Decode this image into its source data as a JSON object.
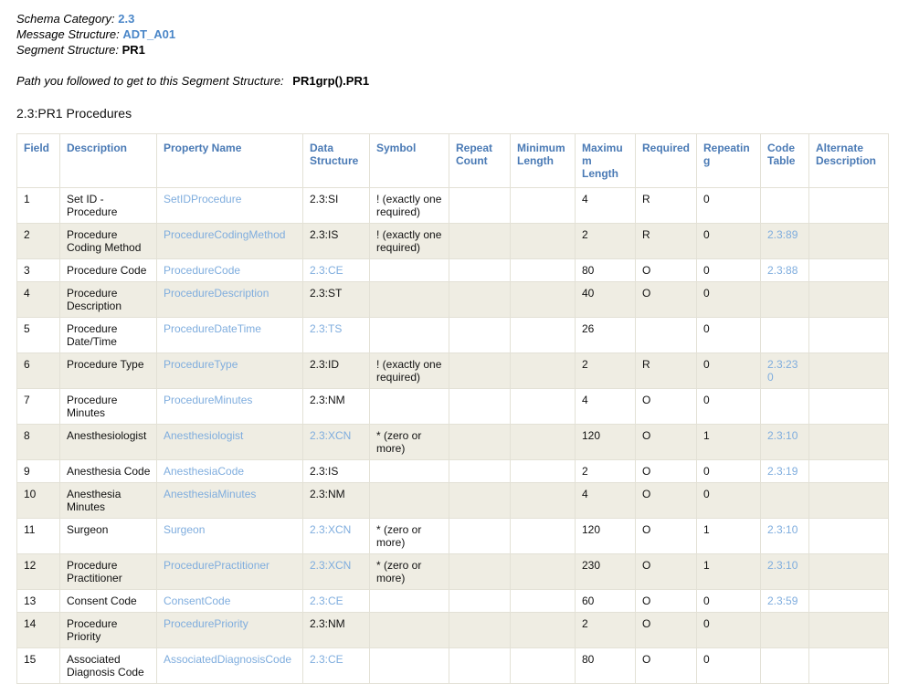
{
  "meta": {
    "schema_category_label": "Schema Category:",
    "schema_category_value": "2.3",
    "message_structure_label": "Message Structure:",
    "message_structure_value": "ADT_A01",
    "segment_structure_label": "Segment Structure:",
    "segment_structure_value": "PR1"
  },
  "path": {
    "label": "Path you followed to get to this Segment Structure:",
    "value": "PR1grp().PR1"
  },
  "section": {
    "title": "2.3:PR1 Procedures"
  },
  "colors": {
    "header_text": "#4a7ab5",
    "link": "#7fadde",
    "meta_link": "#4a86c8",
    "row_alt_bg": "#efede3",
    "border": "#e3e1d6"
  },
  "table": {
    "columns": [
      "Field",
      "Description",
      "Property Name",
      "Data Structure",
      "Symbol",
      "Repeat Count",
      "Minimum Length",
      "Maximum Length",
      "Required",
      "Repeating",
      "Code Table",
      "Alternate Description"
    ],
    "rows": [
      {
        "field": "1",
        "description": "Set ID - Procedure",
        "property_name": "SetIDProcedure",
        "property_name_link": true,
        "data_structure": "2.3:SI",
        "data_structure_link": false,
        "symbol": "! (exactly one required)",
        "repeat_count": "",
        "minimum_length": "",
        "maximum_length": "4",
        "required": "R",
        "repeating": "0",
        "code_table": "",
        "code_table_link": false,
        "alternate_description": ""
      },
      {
        "field": "2",
        "description": "Procedure Coding Method",
        "property_name": "ProcedureCodingMethod",
        "property_name_link": true,
        "data_structure": "2.3:IS",
        "data_structure_link": false,
        "symbol": "! (exactly one required)",
        "repeat_count": "",
        "minimum_length": "",
        "maximum_length": "2",
        "required": "R",
        "repeating": "0",
        "code_table": "2.3:89",
        "code_table_link": true,
        "alternate_description": ""
      },
      {
        "field": "3",
        "description": "Procedure Code",
        "property_name": "ProcedureCode",
        "property_name_link": true,
        "data_structure": "2.3:CE",
        "data_structure_link": true,
        "symbol": "",
        "repeat_count": "",
        "minimum_length": "",
        "maximum_length": "80",
        "required": "O",
        "repeating": "0",
        "code_table": "2.3:88",
        "code_table_link": true,
        "alternate_description": ""
      },
      {
        "field": "4",
        "description": "Procedure Description",
        "property_name": "ProcedureDescription",
        "property_name_link": true,
        "data_structure": "2.3:ST",
        "data_structure_link": false,
        "symbol": "",
        "repeat_count": "",
        "minimum_length": "",
        "maximum_length": "40",
        "required": "O",
        "repeating": "0",
        "code_table": "",
        "code_table_link": false,
        "alternate_description": ""
      },
      {
        "field": "5",
        "description": "Procedure Date/Time",
        "property_name": "ProcedureDateTime",
        "property_name_link": true,
        "data_structure": "2.3:TS",
        "data_structure_link": true,
        "symbol": "",
        "repeat_count": "",
        "minimum_length": "",
        "maximum_length": "26",
        "required": "",
        "repeating": "0",
        "code_table": "",
        "code_table_link": false,
        "alternate_description": ""
      },
      {
        "field": "6",
        "description": "Procedure Type",
        "property_name": "ProcedureType",
        "property_name_link": true,
        "data_structure": "2.3:ID",
        "data_structure_link": false,
        "symbol": "! (exactly one required)",
        "repeat_count": "",
        "minimum_length": "",
        "maximum_length": "2",
        "required": "R",
        "repeating": "0",
        "code_table": "2.3:230",
        "code_table_link": true,
        "alternate_description": ""
      },
      {
        "field": "7",
        "description": "Procedure Minutes",
        "property_name": "ProcedureMinutes",
        "property_name_link": true,
        "data_structure": "2.3:NM",
        "data_structure_link": false,
        "symbol": "",
        "repeat_count": "",
        "minimum_length": "",
        "maximum_length": "4",
        "required": "O",
        "repeating": "0",
        "code_table": "",
        "code_table_link": false,
        "alternate_description": ""
      },
      {
        "field": "8",
        "description": "Anesthesiologist",
        "property_name": "Anesthesiologist",
        "property_name_link": true,
        "data_structure": "2.3:XCN",
        "data_structure_link": true,
        "symbol": "* (zero or more)",
        "repeat_count": "",
        "minimum_length": "",
        "maximum_length": "120",
        "required": "O",
        "repeating": "1",
        "code_table": "2.3:10",
        "code_table_link": true,
        "alternate_description": ""
      },
      {
        "field": "9",
        "description": "Anesthesia Code",
        "property_name": "AnesthesiaCode",
        "property_name_link": true,
        "data_structure": "2.3:IS",
        "data_structure_link": false,
        "symbol": "",
        "repeat_count": "",
        "minimum_length": "",
        "maximum_length": "2",
        "required": "O",
        "repeating": "0",
        "code_table": "2.3:19",
        "code_table_link": true,
        "alternate_description": ""
      },
      {
        "field": "10",
        "description": "Anesthesia Minutes",
        "property_name": "AnesthesiaMinutes",
        "property_name_link": true,
        "data_structure": "2.3:NM",
        "data_structure_link": false,
        "symbol": "",
        "repeat_count": "",
        "minimum_length": "",
        "maximum_length": "4",
        "required": "O",
        "repeating": "0",
        "code_table": "",
        "code_table_link": false,
        "alternate_description": ""
      },
      {
        "field": "11",
        "description": "Surgeon",
        "property_name": "Surgeon",
        "property_name_link": true,
        "data_structure": "2.3:XCN",
        "data_structure_link": true,
        "symbol": "* (zero or more)",
        "repeat_count": "",
        "minimum_length": "",
        "maximum_length": "120",
        "required": "O",
        "repeating": "1",
        "code_table": "2.3:10",
        "code_table_link": true,
        "alternate_description": ""
      },
      {
        "field": "12",
        "description": "Procedure Practitioner",
        "property_name": "ProcedurePractitioner",
        "property_name_link": true,
        "data_structure": "2.3:XCN",
        "data_structure_link": true,
        "symbol": "* (zero or more)",
        "repeat_count": "",
        "minimum_length": "",
        "maximum_length": "230",
        "required": "O",
        "repeating": "1",
        "code_table": "2.3:10",
        "code_table_link": true,
        "alternate_description": ""
      },
      {
        "field": "13",
        "description": "Consent Code",
        "property_name": "ConsentCode",
        "property_name_link": true,
        "data_structure": "2.3:CE",
        "data_structure_link": true,
        "symbol": "",
        "repeat_count": "",
        "minimum_length": "",
        "maximum_length": "60",
        "required": "O",
        "repeating": "0",
        "code_table": "2.3:59",
        "code_table_link": true,
        "alternate_description": ""
      },
      {
        "field": "14",
        "description": "Procedure Priority",
        "property_name": "ProcedurePriority",
        "property_name_link": true,
        "data_structure": "2.3:NM",
        "data_structure_link": false,
        "symbol": "",
        "repeat_count": "",
        "minimum_length": "",
        "maximum_length": "2",
        "required": "O",
        "repeating": "0",
        "code_table": "",
        "code_table_link": false,
        "alternate_description": ""
      },
      {
        "field": "15",
        "description": "Associated Diagnosis Code",
        "property_name": "AssociatedDiagnosisCode",
        "property_name_link": true,
        "data_structure": "2.3:CE",
        "data_structure_link": true,
        "symbol": "",
        "repeat_count": "",
        "minimum_length": "",
        "maximum_length": "80",
        "required": "O",
        "repeating": "0",
        "code_table": "",
        "code_table_link": false,
        "alternate_description": ""
      }
    ]
  }
}
